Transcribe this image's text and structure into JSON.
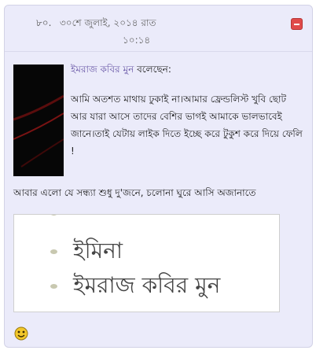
{
  "comment": {
    "number": "৮০.",
    "timestamp_date": "৩০শে জুলাই, ২০১৪ রাত",
    "timestamp_time": "১০:১৪",
    "text": "আবার এলো যে সন্ধ্যা শুধু দু'জনে, চলোনা ঘুরে আসি অজানাতে"
  },
  "quote": {
    "author": "ইমরাজ কবির মুন",
    "said": "বলেছেন:",
    "lines": [
      "আমি অতশত মাথায় ঢুকাই না।আমার ফ্রেন্ডলিস্ট খুবি ছোট",
      "আর যারা আসে তাদের বেশির ভাগই আমাকে ভালভাবেই",
      "জানে।তাই যেটায় লাইক দিতে ইচ্ছে করে টুকুশ করে দিয়ে ফেলি",
      "!"
    ]
  },
  "image_list": {
    "items": [
      "ইমিনা",
      "ইমরাজ কবির মুন"
    ]
  },
  "icons": {
    "close": "close-icon",
    "emoticon": "smiley-icon"
  },
  "colors": {
    "card_background": "#ebebfa",
    "author_link": "#6b5aa8",
    "close_button": "#e04a4a"
  }
}
